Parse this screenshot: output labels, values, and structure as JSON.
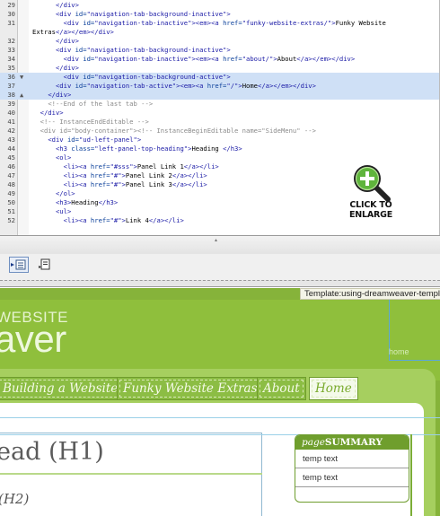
{
  "code": {
    "lines": [
      {
        "num": "29",
        "indent": 6,
        "parts": [
          [
            "tag",
            "</div>"
          ]
        ]
      },
      {
        "num": "30",
        "indent": 6,
        "parts": [
          [
            "tag",
            "<div "
          ],
          [
            "attr",
            "id="
          ],
          [
            "str",
            "\"navigation-tab-background-inactive\""
          ],
          [
            "tag",
            ">"
          ]
        ]
      },
      {
        "num": "31",
        "indent": 8,
        "parts": [
          [
            "tag",
            "<div "
          ],
          [
            "attr",
            "id="
          ],
          [
            "str",
            "\"navigation-tab-inactive\""
          ],
          [
            "tag",
            "><em><a "
          ],
          [
            "attr",
            "href="
          ],
          [
            "str",
            "\"funky-website-extras/\""
          ],
          [
            "tag",
            ">"
          ],
          [
            "txt",
            "Funky Website"
          ]
        ]
      },
      {
        "num": "",
        "indent": 0,
        "parts": [
          [
            "txt",
            "Extras"
          ],
          [
            "tag",
            "</a></em></div>"
          ]
        ]
      },
      {
        "num": "32",
        "indent": 6,
        "parts": [
          [
            "tag",
            "</div>"
          ]
        ]
      },
      {
        "num": "33",
        "indent": 6,
        "parts": [
          [
            "tag",
            "<div "
          ],
          [
            "attr",
            "id="
          ],
          [
            "str",
            "\"navigation-tab-background-inactive\""
          ],
          [
            "tag",
            ">"
          ]
        ]
      },
      {
        "num": "34",
        "indent": 8,
        "parts": [
          [
            "tag",
            "<div "
          ],
          [
            "attr",
            "id="
          ],
          [
            "str",
            "\"navigation-tab-inactive\""
          ],
          [
            "tag",
            "><em><a "
          ],
          [
            "attr",
            "href="
          ],
          [
            "str",
            "\"about/\""
          ],
          [
            "tag",
            ">"
          ],
          [
            "txt",
            "About"
          ],
          [
            "tag",
            "</a></em></div>"
          ]
        ]
      },
      {
        "num": "35",
        "indent": 6,
        "parts": [
          [
            "tag",
            "</div>"
          ]
        ]
      },
      {
        "num": "36",
        "indent": 8,
        "hl": true,
        "parts": [
          [
            "tag",
            "<div "
          ],
          [
            "attr",
            "id="
          ],
          [
            "str",
            "\"navigation-tab-background-active\""
          ],
          [
            "tag",
            ">"
          ]
        ]
      },
      {
        "num": "37",
        "indent": 6,
        "hl": true,
        "parts": [
          [
            "tag",
            "<div "
          ],
          [
            "attr",
            "id="
          ],
          [
            "str",
            "\"navigation-tab-active\""
          ],
          [
            "tag",
            "><em><a "
          ],
          [
            "attr",
            "href="
          ],
          [
            "str",
            "\"/\""
          ],
          [
            "tag",
            ">"
          ],
          [
            "txt",
            "Home"
          ],
          [
            "tag",
            "</a></em></div>"
          ]
        ]
      },
      {
        "num": "38",
        "indent": 4,
        "hl": true,
        "parts": [
          [
            "tag",
            "</div>"
          ]
        ]
      },
      {
        "num": "39",
        "indent": 4,
        "parts": [
          [
            "cmt",
            "<!--End of the last tab -->"
          ]
        ]
      },
      {
        "num": "40",
        "indent": 2,
        "parts": [
          [
            "tag",
            "</div>"
          ]
        ]
      },
      {
        "num": "41",
        "indent": 2,
        "parts": [
          [
            "cmt",
            "<!-- InstanceEndEditable -->"
          ]
        ]
      },
      {
        "num": "42",
        "indent": 2,
        "parts": [
          [
            "cmt",
            "<div id=\"body-container\"><!-- InstanceBeginEditable name=\"SideMenu\" -->"
          ]
        ]
      },
      {
        "num": "43",
        "indent": 4,
        "parts": [
          [
            "tag",
            "<div "
          ],
          [
            "attr",
            "id="
          ],
          [
            "str",
            "\"ud-left-panel\""
          ],
          [
            "tag",
            ">"
          ]
        ]
      },
      {
        "num": "44",
        "indent": 6,
        "parts": [
          [
            "tag",
            "<h3 "
          ],
          [
            "attr",
            "class="
          ],
          [
            "str",
            "\"left-panel-top-heading\""
          ],
          [
            "tag",
            ">"
          ],
          [
            "txt",
            "Heading "
          ],
          [
            "tag",
            "</h3>"
          ]
        ]
      },
      {
        "num": "45",
        "indent": 6,
        "parts": [
          [
            "tag",
            "<ol>"
          ]
        ]
      },
      {
        "num": "46",
        "indent": 8,
        "parts": [
          [
            "tag",
            "<li><a "
          ],
          [
            "attr",
            "href="
          ],
          [
            "str",
            "\"#sss\""
          ],
          [
            "tag",
            ">"
          ],
          [
            "txt",
            "Panel Link 1"
          ],
          [
            "tag",
            "</a></li>"
          ]
        ]
      },
      {
        "num": "47",
        "indent": 8,
        "parts": [
          [
            "tag",
            "<li><a "
          ],
          [
            "attr",
            "href="
          ],
          [
            "str",
            "\"#\""
          ],
          [
            "tag",
            ">"
          ],
          [
            "txt",
            "Panel Link 2"
          ],
          [
            "tag",
            "</a></li>"
          ]
        ]
      },
      {
        "num": "48",
        "indent": 8,
        "parts": [
          [
            "tag",
            "<li><a "
          ],
          [
            "attr",
            "href="
          ],
          [
            "str",
            "\"#\""
          ],
          [
            "tag",
            ">"
          ],
          [
            "txt",
            "Panel Link 3"
          ],
          [
            "tag",
            "</a></li>"
          ]
        ]
      },
      {
        "num": "49",
        "indent": 6,
        "parts": [
          [
            "tag",
            "</ol>"
          ]
        ]
      },
      {
        "num": "50",
        "indent": 6,
        "parts": [
          [
            "tag",
            "<h3>"
          ],
          [
            "txt",
            "Heading"
          ],
          [
            "tag",
            "</h3>"
          ]
        ]
      },
      {
        "num": "51",
        "indent": 6,
        "parts": [
          [
            "tag",
            "<ul>"
          ]
        ]
      },
      {
        "num": "52",
        "indent": 8,
        "parts": [
          [
            "tag",
            "<li><a "
          ],
          [
            "attr",
            "href="
          ],
          [
            "str",
            "\"#\""
          ],
          [
            "tag",
            ">"
          ],
          [
            "txt",
            "Link 4"
          ],
          [
            "tag",
            "</a></li>"
          ]
        ]
      }
    ]
  },
  "enlarge": {
    "line1": "CLICK TO",
    "line2": "ENLARGE",
    "icon": "zoom-plus-icon"
  },
  "toolbar": {
    "icons": [
      "insert-tag-icon",
      "wrap-tag-icon"
    ]
  },
  "design": {
    "template_label": "Template:using-dreamweaver-templ",
    "site_small": "WEBSITE",
    "site_large": "aver",
    "home_link": "home",
    "nav_tabs": [
      "Building a Website",
      "Funky Website Extras",
      "About",
      "Home"
    ],
    "h1": "ead (H1)",
    "h2": "(H2)",
    "summary": {
      "title_italic": "page",
      "title_caps": "SUMMARY",
      "items": [
        "temp text",
        "temp text"
      ]
    }
  },
  "colors": {
    "accent_green": "#86b33a",
    "highlight_blue": "#cfe0f6",
    "tag_blue": "#1a1aa6"
  }
}
